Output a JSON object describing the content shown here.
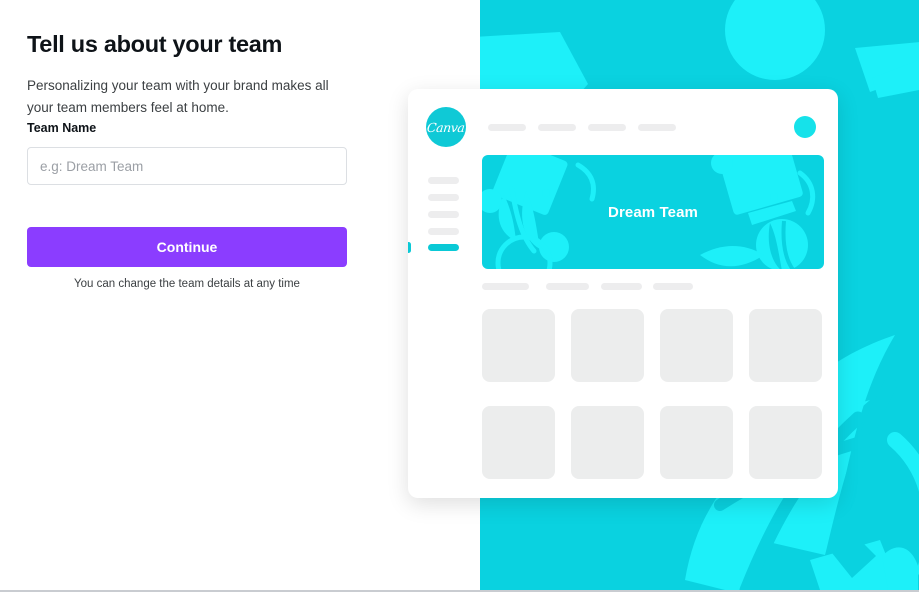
{
  "left": {
    "headline": "Tell us about your team",
    "subtext": "Personalizing your team with your brand makes all your team members feel at home.",
    "field_label": "Team Name",
    "input_value": "",
    "input_placeholder": "e.g: Dream Team",
    "continue_label": "Continue",
    "foot_note": "You can change the team details at any time"
  },
  "preview": {
    "logo_text": "Canva",
    "banner_title": "Dream Team",
    "nav_pills": 4,
    "sidebar_pills": 5,
    "section_pills": 4,
    "thumbnails": 8
  },
  "colors": {
    "accent_purple": "#8b3dff",
    "brand_cyan": "#0ad2e0",
    "light_cyan": "#1df0f9",
    "logo_cyan": "#0fc9d6",
    "placeholder_grey": "#ededee",
    "thumb_grey": "#eceded",
    "text_dark": "#0e1318",
    "text_body": "#3c4043",
    "input_border": "#dcdfe3"
  }
}
